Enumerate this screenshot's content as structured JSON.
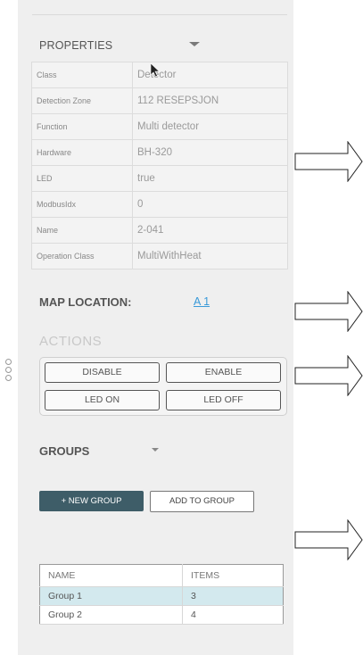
{
  "properties": {
    "header": "PROPERTIES",
    "rows": [
      {
        "key": "Class",
        "value": "Detector"
      },
      {
        "key": "Detection Zone",
        "value": "112 RESEPSJON"
      },
      {
        "key": "Function",
        "value": "Multi detector"
      },
      {
        "key": "Hardware",
        "value": "BH-320"
      },
      {
        "key": "LED",
        "value": "true"
      },
      {
        "key": "ModbusIdx",
        "value": "0"
      },
      {
        "key": "Name",
        "value": "2-041"
      },
      {
        "key": "Operation Class",
        "value": "MultiWithHeat"
      }
    ]
  },
  "map": {
    "label": "MAP LOCATION:",
    "link": "A 1"
  },
  "actions": {
    "title": "ACTIONS",
    "disable": "DISABLE",
    "enable": "ENABLE",
    "led_on": "LED ON",
    "led_off": "LED OFF"
  },
  "groups": {
    "title": "GROUPS",
    "new_group": "+ NEW GROUP",
    "add_to_group": "ADD TO GROUP",
    "columns": [
      "NAME",
      "ITEMS"
    ],
    "rows": [
      {
        "name": "Group 1",
        "items": "3",
        "selected": true
      },
      {
        "name": "Group 2",
        "items": "4",
        "selected": false
      }
    ]
  },
  "colors": {
    "panel": "#efefef",
    "primary_button": "#3e5d68",
    "link": "#3a9ad9",
    "selected_row": "#d3e9ee"
  },
  "icons": [
    "chevron-down-icon",
    "mouse-cursor-icon",
    "drag-handle-icon",
    "arrow-icon"
  ]
}
